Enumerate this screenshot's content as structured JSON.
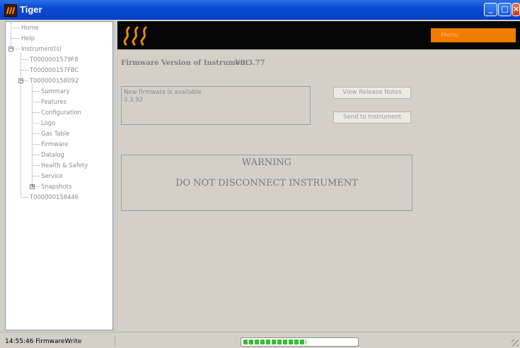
{
  "window": {
    "title": "Tiger",
    "controls": [
      "minimize",
      "maximize",
      "close"
    ]
  },
  "tree": {
    "items": [
      {
        "label": "Home",
        "level": 0,
        "expander": null
      },
      {
        "label": "Help",
        "level": 0,
        "expander": null
      },
      {
        "label": "Instrument(s)",
        "level": 0,
        "expander": "-"
      },
      {
        "label": "T0000001579F8",
        "level": 1,
        "expander": null
      },
      {
        "label": "T000000157FBC",
        "level": 1,
        "expander": null
      },
      {
        "label": "T000000158092",
        "level": 1,
        "expander": "-"
      },
      {
        "label": "Summary",
        "level": 2,
        "expander": null
      },
      {
        "label": "Features",
        "level": 2,
        "expander": null
      },
      {
        "label": "Configuration",
        "level": 2,
        "expander": null
      },
      {
        "label": "Logo",
        "level": 2,
        "expander": null
      },
      {
        "label": "Gas Table",
        "level": 2,
        "expander": null
      },
      {
        "label": "Firmware",
        "level": 2,
        "expander": null
      },
      {
        "label": "Datalog",
        "level": 2,
        "expander": null
      },
      {
        "label": "Health & Safety",
        "level": 2,
        "expander": null
      },
      {
        "label": "Service",
        "level": 2,
        "expander": null
      },
      {
        "label": "Snapshots",
        "level": 2,
        "expander": "+"
      },
      {
        "label": "T000000158446",
        "level": 1,
        "expander": null
      }
    ]
  },
  "header": {
    "logo_icon": "flame-logo-icon",
    "menu_label": "Menu"
  },
  "firmware": {
    "label": "Firmware Version of Instrument",
    "version": "V0.3.77",
    "new_available_text": "New firmware is available",
    "new_version": "0.3.92",
    "release_notes_button": "View Release Notes",
    "send_button": "Send to Instrument"
  },
  "warning": {
    "title": "WARNING",
    "message": "DO NOT DISCONNECT INSTRUMENT"
  },
  "status": {
    "text": "14:55:46 FirmwareWrite",
    "progress": 0.55
  },
  "colors": {
    "titlebar": "#0a4ad6",
    "banner": "#050505",
    "accent_orange": "#f07d00",
    "progress_green": "#35c02f"
  }
}
